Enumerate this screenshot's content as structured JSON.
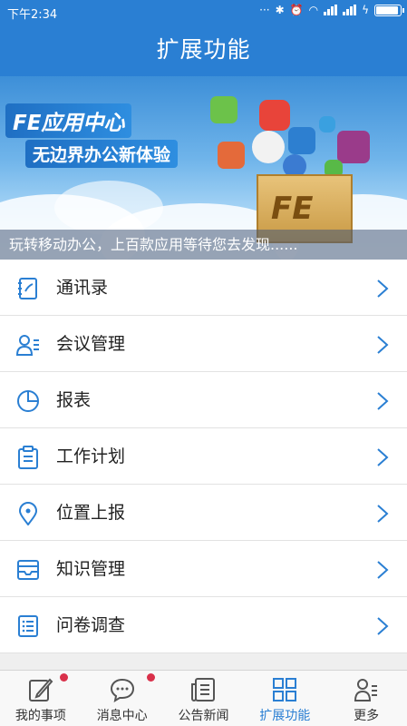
{
  "status_bar": {
    "time": "下午2:34",
    "battery_level": 0.85
  },
  "title": "扩展功能",
  "banner": {
    "brand": "FE应用中心",
    "slogan": "无边界办公新体验",
    "box_logo": "FE",
    "caption": "玩转移动办公，上百款应用等待您去发现......"
  },
  "menu": [
    {
      "label": "通讯录",
      "icon": "contacts-book-icon"
    },
    {
      "label": "会议管理",
      "icon": "meeting-people-icon"
    },
    {
      "label": "报表",
      "icon": "pie-chart-icon"
    },
    {
      "label": "工作计划",
      "icon": "clipboard-icon"
    },
    {
      "label": "位置上报",
      "icon": "location-pin-icon"
    },
    {
      "label": "知识管理",
      "icon": "inbox-tray-icon"
    },
    {
      "label": "问卷调查",
      "icon": "list-document-icon"
    }
  ],
  "tabs": [
    {
      "label": "我的事项",
      "icon": "pencil-edit-icon",
      "badge": true,
      "active": false
    },
    {
      "label": "消息中心",
      "icon": "chat-bubble-icon",
      "badge": true,
      "active": false
    },
    {
      "label": "公告新闻",
      "icon": "news-document-icon",
      "badge": false,
      "active": false
    },
    {
      "label": "扩展功能",
      "icon": "grid-apps-icon",
      "badge": false,
      "active": true
    },
    {
      "label": "更多",
      "icon": "more-person-icon",
      "badge": false,
      "active": false
    }
  ],
  "colors": {
    "primary": "#2a7fd3",
    "badge": "#d9304a",
    "text": "#222222"
  }
}
